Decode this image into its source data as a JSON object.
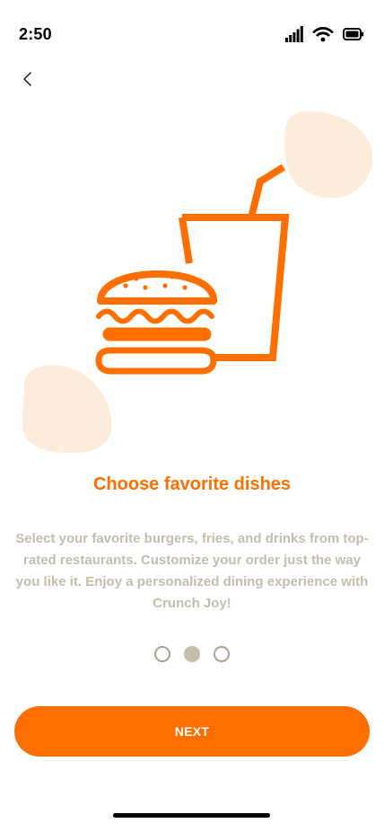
{
  "status_bar": {
    "time": "2:50"
  },
  "onboarding": {
    "title": "Choose favorite dishes",
    "description": "Select your favorite burgers, fries, and drinks from top-rated restaurants. Customize your order just the way you like it. Enjoy a personalized dining experience with Crunch Joy!",
    "current_page": 2,
    "page_count": 3,
    "next_label": "NEXT"
  },
  "colors": {
    "accent": "#FF6F00",
    "blob": "#FDEBDB",
    "muted_text": "#C4BEAD",
    "dot_outline": "#A9A394"
  },
  "icons": {
    "back": "chevron-left-icon",
    "illustration": "burger-and-drink-icon",
    "signal": "cellular-signal-icon",
    "wifi": "wifi-icon",
    "battery": "battery-icon"
  }
}
